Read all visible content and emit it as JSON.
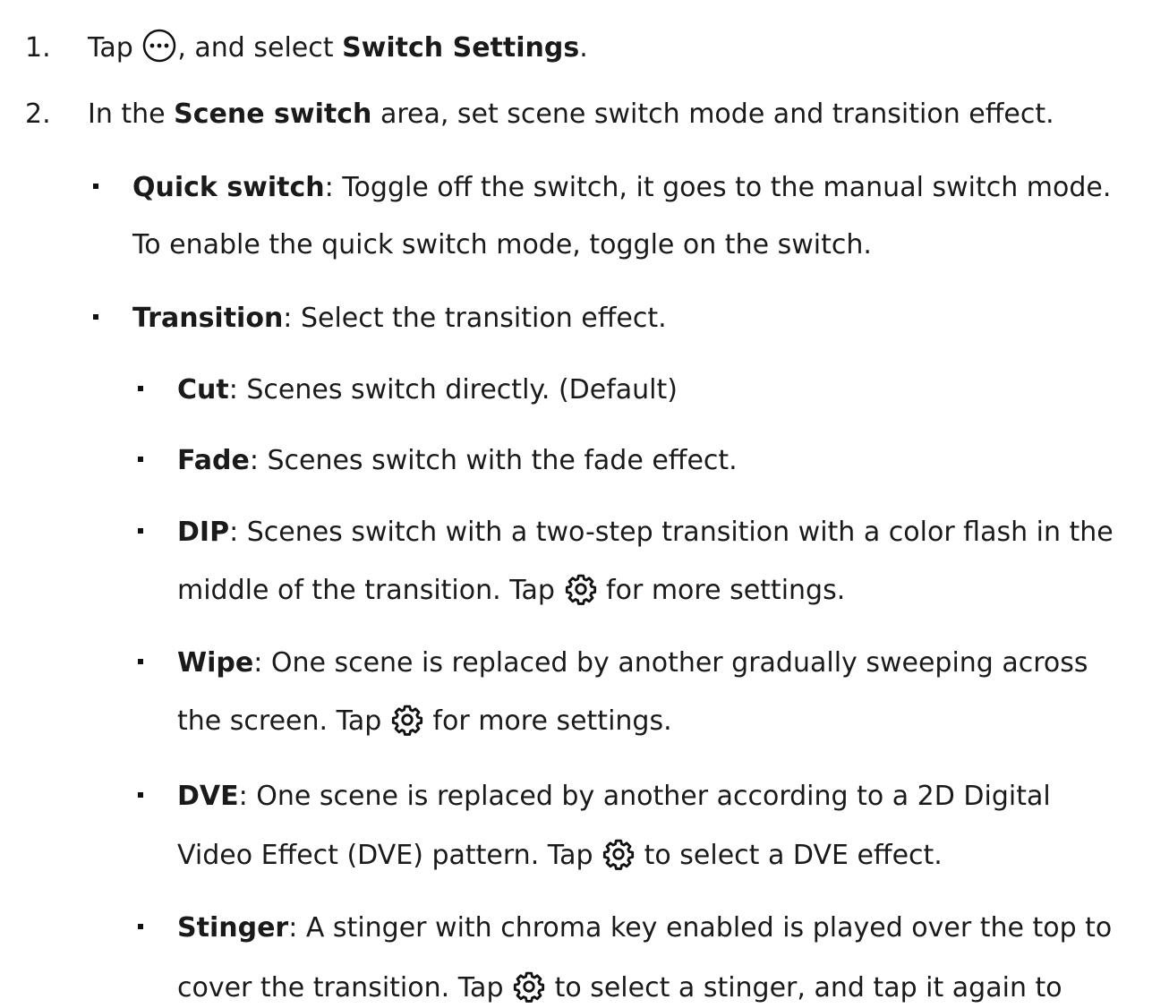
{
  "steps": [
    {
      "number": "1.",
      "before": "Tap ",
      "icon": "more-horizontal-icon",
      "middle": ", and select ",
      "bold": "Switch Settings",
      "after": "."
    },
    {
      "number": "2.",
      "before": "In the ",
      "bold": "Scene switch",
      "after": " area, set scene switch mode and transition effect."
    }
  ],
  "items": {
    "quick_switch": {
      "term": "Quick switch",
      "line1": ": Toggle off the switch, it goes to the manual switch mode.",
      "line2": "To enable the quick switch mode, toggle on the switch."
    },
    "transition": {
      "term": "Transition",
      "text": ": Select the transition effect."
    },
    "cut": {
      "term": "Cut",
      "text": ": Scenes switch directly. (Default)"
    },
    "fade": {
      "term": "Fade",
      "text": ": Scenes switch with the fade effect."
    },
    "dip": {
      "term": "DIP",
      "line1": ": Scenes switch with a two-step transition with a color flash in the",
      "line2_before": "middle of the transition. Tap ",
      "icon": "gear-icon",
      "line2_after": " for more settings."
    },
    "wipe": {
      "term": "Wipe",
      "line1": ": One scene is replaced by another gradually sweeping across",
      "line2_before": "the screen. Tap ",
      "icon": "gear-icon",
      "line2_after": " for more settings."
    },
    "dve": {
      "term": "DVE",
      "line1": ": One scene is replaced by another according to a 2D Digital",
      "line2_before": "Video Effect (DVE) pattern. Tap ",
      "icon": "gear-icon",
      "line2_after": " to select a DVE effect."
    },
    "stinger": {
      "term": "Stinger",
      "line1": ": A stinger with chroma key enabled is played over the top to",
      "line2_before": "cover the transition. Tap ",
      "icon": "gear-icon",
      "line2_after": " to select a stinger, and tap it again to"
    }
  }
}
